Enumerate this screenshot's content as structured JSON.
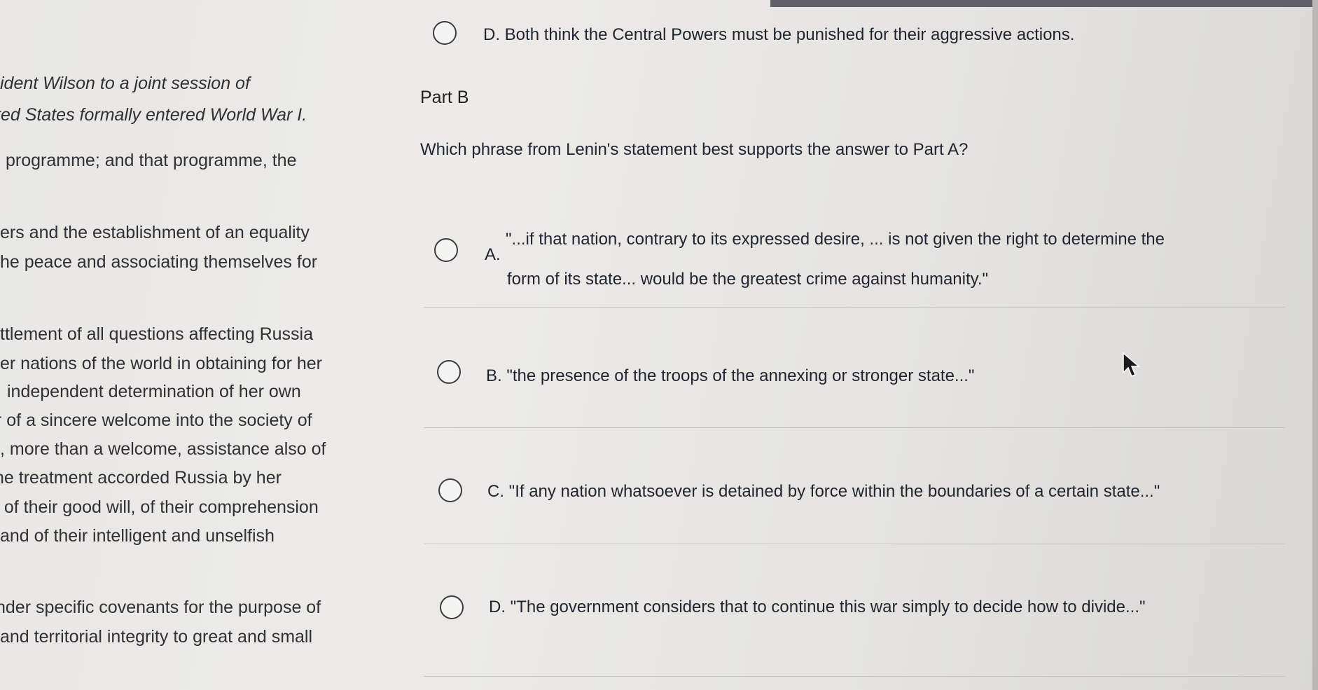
{
  "left_passage": {
    "lines": [
      "ident Wilson to a joint session of",
      "ted States formally entered World War I.",
      "programme; and that programme, the",
      "ers and the establishment of an equality",
      "he peace and associating themselves for",
      "ttlement of all questions affecting Russia",
      "er nations of the world in obtaining for her",
      "independent determination of her own",
      "r of a sincere welcome into the society of",
      ", more than a welcome, assistance also of",
      "he treatment accorded Russia by her",
      "t of their good will, of their comprehension",
      "and of their intelligent and unselfish",
      "nder specific covenants for the purpose of",
      "and territorial integrity to great and small"
    ]
  },
  "part_a_remaining": {
    "option_d": "D. Both think the Central Powers must be punished for their aggressive actions."
  },
  "part_b": {
    "label": "Part B",
    "question": "Which phrase from Lenin's statement best supports the answer to Part A?",
    "options": [
      {
        "letter": "A.",
        "line1": "\"...if that nation, contrary to its expressed desire, ... is not given the right to determine the",
        "line2": "form of its state... would be the greatest crime against humanity.\""
      },
      {
        "text": "B. \"the presence of the troops of the annexing or stronger state...\""
      },
      {
        "text": "C. \"If any nation whatsoever is detained by force within the boundaries of a certain state...\""
      },
      {
        "text": "D. \"The government considers that to continue this war simply to decide how to divide...\""
      }
    ]
  }
}
